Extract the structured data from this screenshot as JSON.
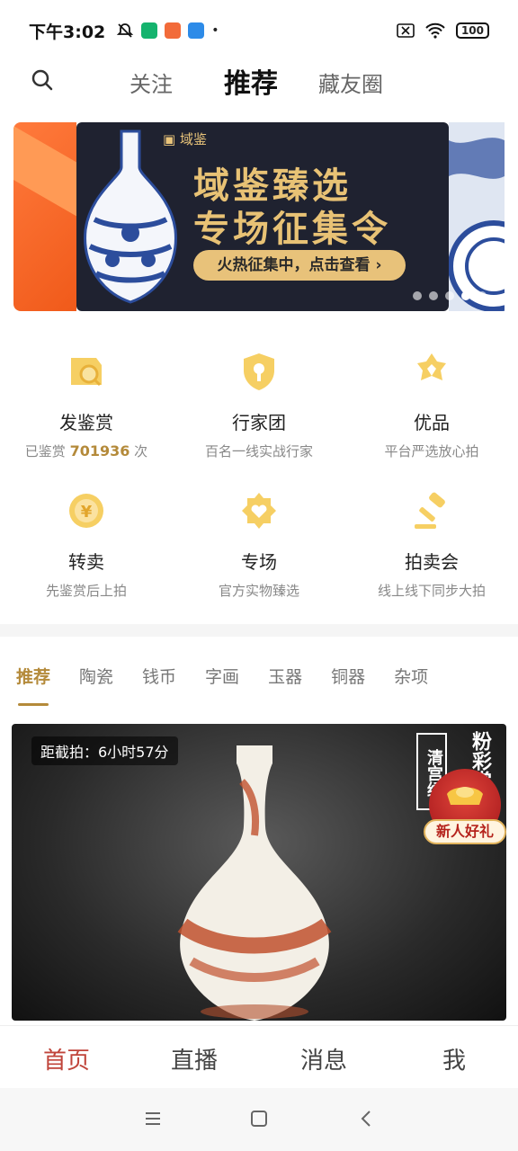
{
  "status": {
    "time": "下午3:02",
    "battery": "100"
  },
  "header": {
    "tabs": [
      "关注",
      "推荐",
      "藏友圈"
    ],
    "active_tab": "推荐"
  },
  "banner": {
    "logo": "域鉴",
    "title_line1": "域鉴臻选",
    "title_line2": "专场征集令",
    "cta": "火热征集中，点击查看 ›",
    "dots": 5,
    "active_dot": 4
  },
  "features": [
    {
      "title": "发鉴赏",
      "sub_prefix": "已鉴赏",
      "sub_num": "701936",
      "sub_suffix": "次",
      "icon": "appraisal-icon"
    },
    {
      "title": "行家团",
      "sub": "百名一线实战行家",
      "icon": "shield-key-icon"
    },
    {
      "title": "优品",
      "sub": "平台严选放心拍",
      "icon": "star-badge-icon"
    },
    {
      "title": "转卖",
      "sub": "先鉴赏后上拍",
      "icon": "yuan-exchange-icon"
    },
    {
      "title": "专场",
      "sub": "官方实物臻选",
      "icon": "heart-seal-icon"
    },
    {
      "title": "拍卖会",
      "sub": "线上线下同步大拍",
      "icon": "gavel-icon"
    }
  ],
  "categories": [
    "推荐",
    "陶瓷",
    "钱币",
    "字画",
    "玉器",
    "铜器",
    "杂项"
  ],
  "product": {
    "countdown": "距截拍：6小时57分",
    "vertical_title": "粉彩赏瓶官",
    "badge": "清宫绣",
    "gift": "新人好礼"
  },
  "bottom_nav": [
    "首页",
    "直播",
    "消息",
    "我"
  ],
  "colors": {
    "gold": "#b48a3a",
    "nav_active": "#c0443a",
    "banner_bg": "#1f2230"
  }
}
